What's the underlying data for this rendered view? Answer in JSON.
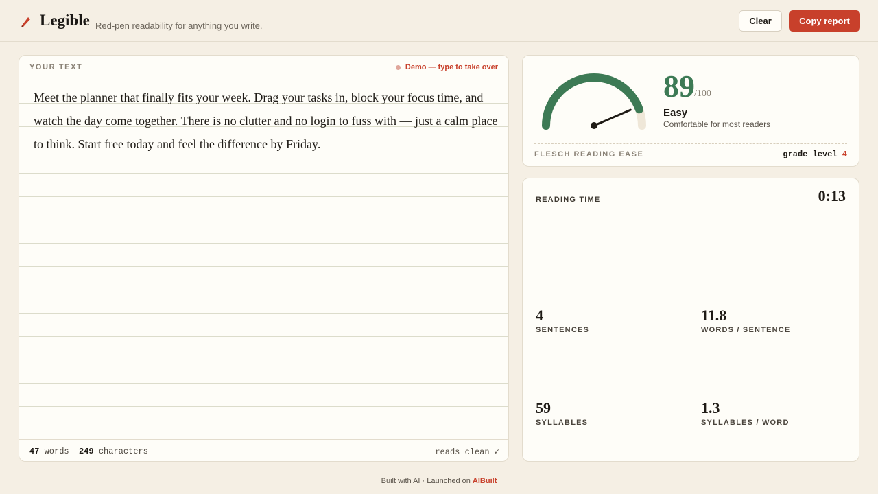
{
  "header": {
    "brand": "Legible",
    "tagline": "Red-pen readability for anything you write.",
    "clear_label": "Clear",
    "copy_label": "Copy report"
  },
  "editor": {
    "label": "YOUR TEXT",
    "demo_badge": "Demo — type to take over",
    "text": "Meet the planner that finally fits your week. Drag your tasks in, block your focus time, and watch the day come together. There is no clutter and no login to fuss with — just a calm place to think. Start free today and feel the difference by Friday.",
    "word_count": "47",
    "word_unit": "words",
    "char_count": "249",
    "char_unit": "characters",
    "status": "reads clean ✓"
  },
  "score": {
    "value": "89",
    "max": "/100",
    "level": "Easy",
    "description": "Comfortable for most readers",
    "metric_label": "FLESCH READING EASE",
    "grade_label": "grade level",
    "grade_value": "4",
    "gauge_fraction": 0.89,
    "gauge_color": "#3d7a55",
    "gauge_track_color": "#efe7d8"
  },
  "stats": {
    "reading_time_label": "READING TIME",
    "reading_time": "0:13",
    "items": [
      {
        "value": "4",
        "label": "SENTENCES"
      },
      {
        "value": "11.8",
        "label": "WORDS / SENTENCE"
      },
      {
        "value": "59",
        "label": "SYLLABLES"
      },
      {
        "value": "1.3",
        "label": "SYLLABLES / WORD"
      }
    ]
  },
  "footer": {
    "text": "Built with AI · Launched on ",
    "link": "AIBuilt"
  },
  "colors": {
    "accent": "#c8402b",
    "score_green": "#3d7a55",
    "background": "#f5efe4"
  },
  "icons": {
    "brand": "red-pen-icon",
    "demo": "dot-icon"
  }
}
